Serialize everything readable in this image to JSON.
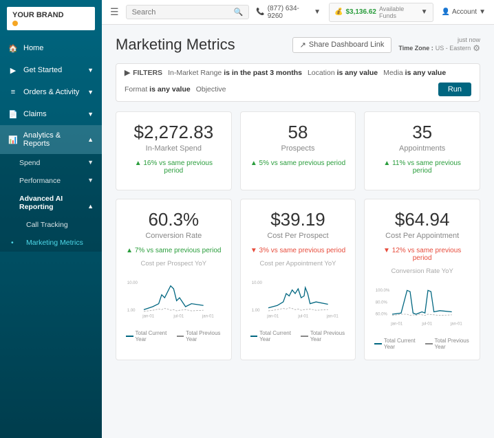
{
  "sidebar": {
    "logo": {
      "line1": "YOUR BRAND",
      "line2": ""
    },
    "items": [
      {
        "id": "home",
        "label": "Home",
        "icon": "🏠",
        "hasChevron": false
      },
      {
        "id": "get-started",
        "label": "Get Started",
        "icon": "▶",
        "hasChevron": true
      },
      {
        "id": "orders",
        "label": "Orders & Activity",
        "icon": "📋",
        "hasChevron": true
      },
      {
        "id": "claims",
        "label": "Claims",
        "icon": "📄",
        "hasChevron": true
      },
      {
        "id": "analytics",
        "label": "Analytics & Reports",
        "icon": "📊",
        "hasChevron": true,
        "expanded": true
      }
    ],
    "sub_items": [
      {
        "id": "spend",
        "label": "Spend",
        "hasChevron": true
      },
      {
        "id": "performance",
        "label": "Performance",
        "hasChevron": true
      },
      {
        "id": "ai-reporting",
        "label": "Advanced AI Reporting",
        "hasChevron": true,
        "expanded": true
      },
      {
        "id": "call-tracking",
        "label": "Call Tracking",
        "indent": true
      },
      {
        "id": "marketing-metrics",
        "label": "Marketing Metrics",
        "indent": true,
        "active": true
      }
    ]
  },
  "topbar": {
    "search_placeholder": "Search",
    "phone": "(877) 634-9260",
    "funds_label": "Available Funds",
    "funds_amount": "$3,136.62",
    "account_label": "Account"
  },
  "page": {
    "title": "Marketing Metrics",
    "share_btn": "Share Dashboard Link",
    "time_label": "just now",
    "timezone_label": "Time Zone :",
    "timezone_value": "US - Eastern"
  },
  "filters": {
    "label": "FILTERS",
    "items": [
      "In-Market Range is in the past 3 months",
      "Location is any value",
      "Media is any value",
      "Format is any value",
      "Objective"
    ],
    "run_btn": "Run"
  },
  "metrics": [
    {
      "id": "in-market-spend",
      "value": "$2,272.83",
      "label": "In-Market Spend",
      "change": "▲ 16% vs same previous period",
      "change_type": "up",
      "chart_title": "",
      "has_chart": false
    },
    {
      "id": "prospects",
      "value": "58",
      "label": "Prospects",
      "change": "▲ 5% vs same previous period",
      "change_type": "up",
      "chart_title": "",
      "has_chart": false
    },
    {
      "id": "appointments",
      "value": "35",
      "label": "Appointments",
      "change": "▲ 11% vs same previous period",
      "change_type": "up",
      "chart_title": "",
      "has_chart": false
    },
    {
      "id": "conversion-rate",
      "value": "60.3%",
      "label": "Conversion Rate",
      "change": "▲ 7% vs same previous period",
      "change_type": "up",
      "chart_title": "Cost per Prospect YoY",
      "has_chart": true
    },
    {
      "id": "cost-per-prospect",
      "value": "$39.19",
      "label": "Cost Per Prospect",
      "change": "▼ 3% vs same previous period",
      "change_type": "down",
      "chart_title": "Cost per Appointment YoY",
      "has_chart": true
    },
    {
      "id": "cost-per-appointment",
      "value": "$64.94",
      "label": "Cost Per Appointment",
      "change": "▼ 12% vs same previous period",
      "change_type": "down",
      "chart_title": "Conversion Rate YoY",
      "has_chart": true
    }
  ],
  "chart_legend": {
    "current": "Total Current Year",
    "previous": "Total Previous Year"
  },
  "colors": {
    "primary": "#006680",
    "success": "#2a9d3c",
    "danger": "#e74c3c",
    "sidebar_bg": "#006680"
  }
}
